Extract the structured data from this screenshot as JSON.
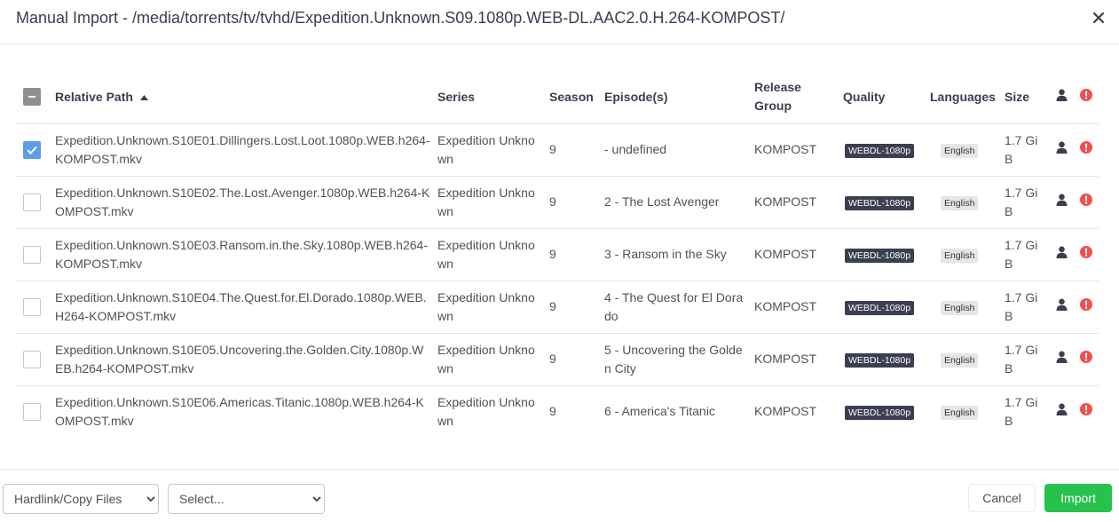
{
  "dialog": {
    "title": "Manual Import - /media/torrents/tv/tvhd/Expedition.Unknown.S09.1080p.WEB-DL.AAC2.0.H.264-KOMPOST/"
  },
  "table": {
    "columns": {
      "relative_path": "Relative Path",
      "series": "Series",
      "season": "Season",
      "episodes": "Episode(s)",
      "release_group": "Release Group",
      "quality": "Quality",
      "languages": "Languages",
      "size": "Size"
    },
    "sort": {
      "column": "Relative Path",
      "direction": "ascending"
    },
    "header_checkbox_state": "indeterminate",
    "rows": [
      {
        "checked": true,
        "path": "Expedition.Unknown.S10E01.Dillingers.Lost.Loot.1080p.WEB.h264-KOMPOST.mkv",
        "series": "Expedition Unknown",
        "season": "9",
        "episode": "- undefined",
        "release_group": "KOMPOST",
        "quality": "WEBDL-1080p",
        "language": "English",
        "size": "1.7 GiB"
      },
      {
        "checked": false,
        "path": "Expedition.Unknown.S10E02.The.Lost.Avenger.1080p.WEB.h264-KOMPOST.mkv",
        "series": "Expedition Unknown",
        "season": "9",
        "episode": "2 - The Lost Avenger",
        "release_group": "KOMPOST",
        "quality": "WEBDL-1080p",
        "language": "English",
        "size": "1.7 GiB"
      },
      {
        "checked": false,
        "path": "Expedition.Unknown.S10E03.Ransom.in.the.Sky.1080p.WEB.h264-KOMPOST.mkv",
        "series": "Expedition Unknown",
        "season": "9",
        "episode": "3 - Ransom in the Sky",
        "release_group": "KOMPOST",
        "quality": "WEBDL-1080p",
        "language": "English",
        "size": "1.7 GiB"
      },
      {
        "checked": false,
        "path": "Expedition.Unknown.S10E04.The.Quest.for.El.Dorado.1080p.WEB.H264-KOMPOST.mkv",
        "series": "Expedition Unknown",
        "season": "9",
        "episode": "4 - The Quest for El Dorado",
        "release_group": "KOMPOST",
        "quality": "WEBDL-1080p",
        "language": "English",
        "size": "1.7 GiB"
      },
      {
        "checked": false,
        "path": "Expedition.Unknown.S10E05.Uncovering.the.Golden.City.1080p.WEB.h264-KOMPOST.mkv",
        "series": "Expedition Unknown",
        "season": "9",
        "episode": "5 - Uncovering the Golden City",
        "release_group": "KOMPOST",
        "quality": "WEBDL-1080p",
        "language": "English",
        "size": "1.7 GiB"
      },
      {
        "checked": false,
        "path": "Expedition.Unknown.S10E06.Americas.Titanic.1080p.WEB.h264-KOMPOST.mkv",
        "series": "Expedition Unknown",
        "season": "9",
        "episode": "6 - America's Titanic",
        "release_group": "KOMPOST",
        "quality": "WEBDL-1080p",
        "language": "English",
        "size": "1.7 GiB"
      }
    ]
  },
  "footer": {
    "import_mode": "Hardlink/Copy Files",
    "select_placeholder": "Select...",
    "cancel_label": "Cancel",
    "import_label": "Import"
  },
  "icons": {
    "close": "close-icon",
    "person": "person-icon",
    "warning": "warning-icon",
    "sort": "sort-ascending-icon"
  },
  "colors": {
    "checkbox_checked": "#5d9cec",
    "checkbox_indeterminate": "#909090",
    "quality_badge": "#3a3f51",
    "language_badge": "#e6e6e6",
    "warning": "#f05050",
    "import_button": "#27c24c"
  }
}
